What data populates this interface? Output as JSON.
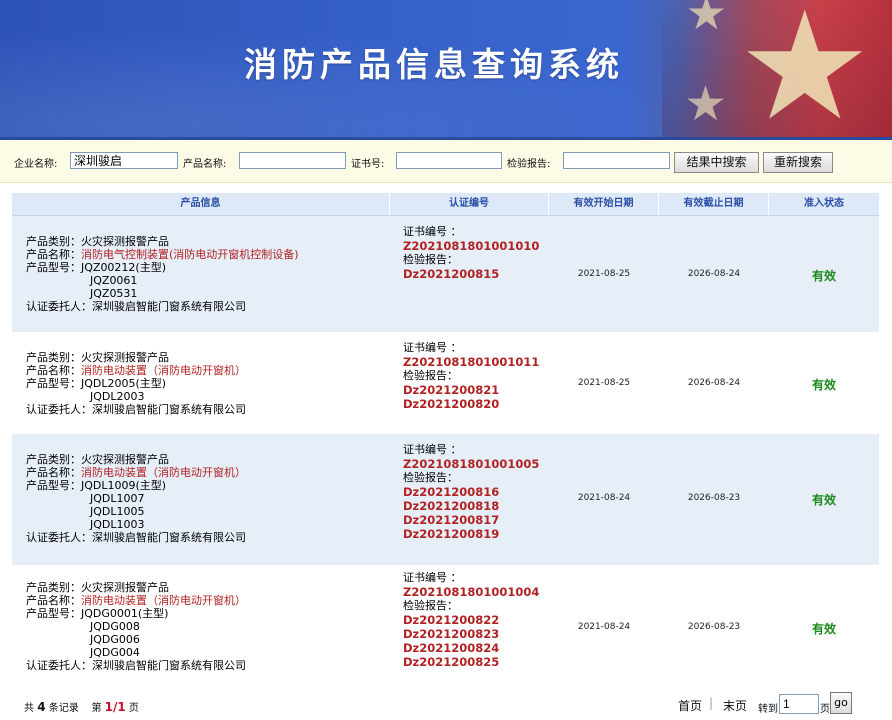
{
  "header": {
    "title": "消防产品信息查询系统"
  },
  "search": {
    "company_label": "企业名称:",
    "company_value": "深圳骏启",
    "product_label": "产品名称:",
    "product_value": "",
    "cert_label": "证书号:",
    "cert_value": "",
    "report_label": "检验报告:",
    "report_value": "",
    "search_in_results": "结果中搜索",
    "search_again": "重新搜索"
  },
  "table": {
    "headers": [
      "产品信息",
      "认证编号",
      "有效开始日期",
      "有效截止日期",
      "准入状态"
    ],
    "labels": {
      "category": "产品类别：",
      "name": "产品名称：",
      "model": "产品型号：",
      "entrust": "认证委托人：",
      "cert_no": "证书编号 ：",
      "report": "检验报告："
    },
    "rows": [
      {
        "category": "火灾探测报警产品",
        "name": "消防电气控制装置(消防电动开窗机控制设备)",
        "models": [
          "JQZ00212(主型)",
          "JQZ0061",
          "JQZ0531"
        ],
        "entrust": "深圳骏启智能门窗系统有限公司",
        "cert": "Z2021081801001010",
        "reports": [
          "Dz2021200815"
        ],
        "start": "2021-08-25",
        "end": "2026-08-24",
        "status": "有效"
      },
      {
        "category": "火灾探测报警产品",
        "name": "消防电动装置（消防电动开窗机）",
        "models": [
          "JQDL2005(主型)",
          "JQDL2003"
        ],
        "entrust": "深圳骏启智能门窗系统有限公司",
        "cert": "Z2021081801001011",
        "reports": [
          "Dz2021200821",
          "Dz2021200820"
        ],
        "start": "2021-08-25",
        "end": "2026-08-24",
        "status": "有效"
      },
      {
        "category": "火灾探测报警产品",
        "name": "消防电动装置（消防电动开窗机）",
        "models": [
          "JQDL1009(主型)",
          "JQDL1007",
          "JQDL1005",
          "JQDL1003"
        ],
        "entrust": "深圳骏启智能门窗系统有限公司",
        "cert": "Z2021081801001005",
        "reports": [
          "Dz2021200816",
          "Dz2021200818",
          "Dz2021200817",
          "Dz2021200819"
        ],
        "start": "2021-08-24",
        "end": "2026-08-23",
        "status": "有效"
      },
      {
        "category": "火灾探测报警产品",
        "name": "消防电动装置（消防电动开窗机）",
        "models": [
          "JQDG0001(主型)",
          "JQDG008",
          "JQDG006",
          "JQDG004"
        ],
        "entrust": "深圳骏启智能门窗系统有限公司",
        "cert": "Z2021081801001004",
        "reports": [
          "Dz2021200822",
          "Dz2021200823",
          "Dz2021200824",
          "Dz2021200825"
        ],
        "start": "2021-08-24",
        "end": "2026-08-23",
        "status": "有效"
      }
    ]
  },
  "footer": {
    "total_prefix": "共",
    "total_count": "4",
    "total_suffix": "条记录",
    "page_prefix": "第",
    "page_current": "1/1",
    "page_suffix": "页",
    "first": "首页",
    "last": "末页",
    "goto_label": "转到",
    "goto_value": "1",
    "goto_suffix": "页",
    "go": "go"
  }
}
